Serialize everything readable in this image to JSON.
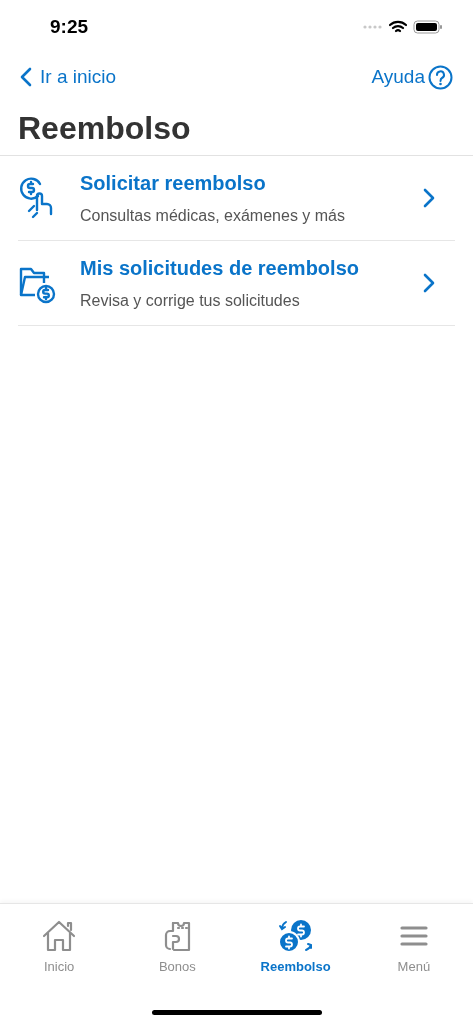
{
  "status_bar": {
    "time": "9:25"
  },
  "nav": {
    "back": "Ir a inicio",
    "help": "Ayuda"
  },
  "title": "Reembolso",
  "items": [
    {
      "kind": "request",
      "title": "Solicitar reembolso",
      "subtitle": "Consultas médicas, exámenes y más"
    },
    {
      "kind": "folder",
      "title": "Mis solicitudes de reembolso",
      "subtitle": "Revisa y corrige tus solicitudes"
    }
  ],
  "tabs": [
    {
      "kind": "home",
      "label": "Inicio",
      "selected": false
    },
    {
      "kind": "voucher",
      "label": "Bonos",
      "selected": false
    },
    {
      "kind": "coins",
      "label": "Reembolso",
      "selected": true
    },
    {
      "kind": "menu",
      "label": "Menú",
      "selected": false
    }
  ]
}
